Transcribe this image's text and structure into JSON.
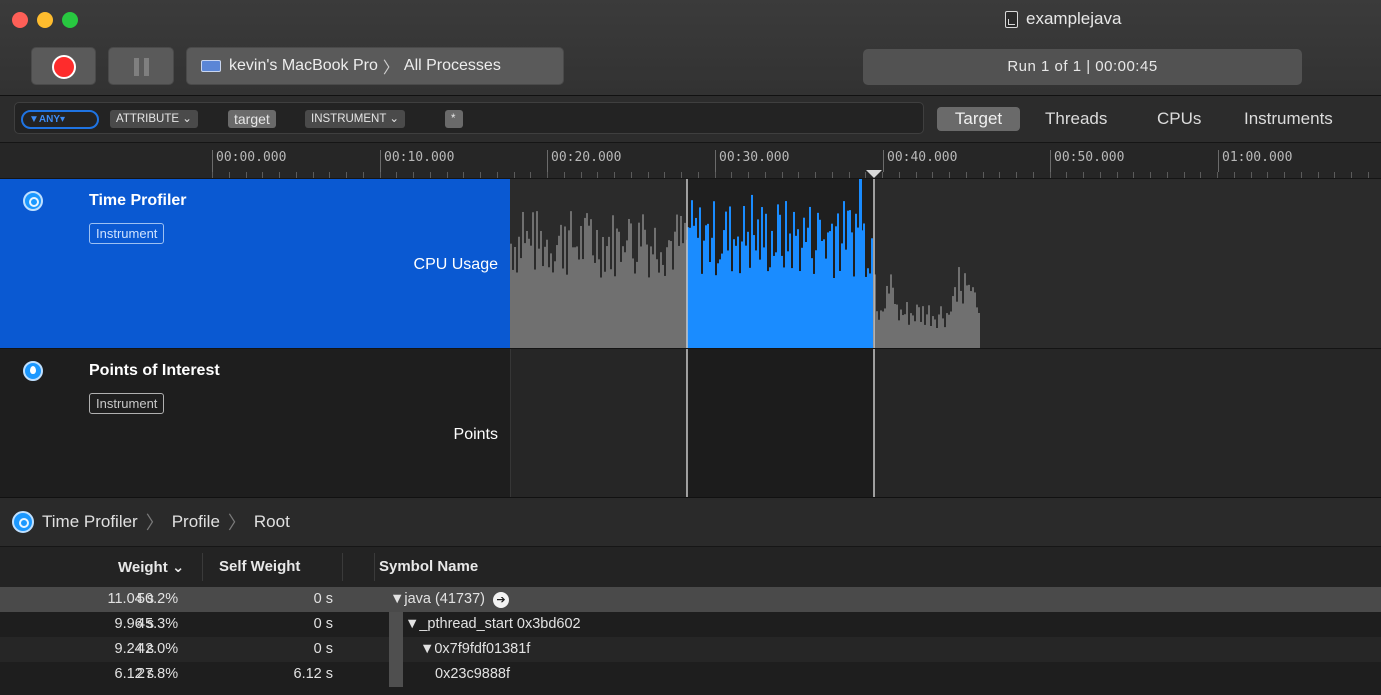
{
  "window": {
    "title": "examplejava",
    "device": "kevin's MacBook Pro",
    "device_sep": "〉",
    "target_process": "All Processes",
    "run_status": "Run 1 of 1  |  00:00:45"
  },
  "filter": {
    "any_token": "▼ANY▾",
    "attribute_token": "ATTRIBUTE ⌄",
    "target_value": "target",
    "instrument_token": "INSTRUMENT ⌄",
    "star_token": "*"
  },
  "view_tabs": [
    {
      "label": "Target",
      "selected": true
    },
    {
      "label": "Threads",
      "selected": false
    },
    {
      "label": "CPUs",
      "selected": false
    },
    {
      "label": "Instruments",
      "selected": false
    }
  ],
  "ruler": {
    "ticks": [
      "00:00.000",
      "00:10.000",
      "00:20.000",
      "00:30.000",
      "00:40.000",
      "00:50.000",
      "01:00.000"
    ]
  },
  "tracks": [
    {
      "name": "Time Profiler",
      "badge": "Instrument",
      "series": "CPU Usage",
      "selected": true
    },
    {
      "name": "Points of Interest",
      "badge": "Instrument",
      "series": "Points",
      "selected": false
    }
  ],
  "detail": {
    "breadcrumbs": [
      "Time Profiler",
      "Profile",
      "Root"
    ],
    "columns": {
      "weight": "Weight ⌄",
      "self_weight": "Self Weight",
      "symbol": "Symbol Name"
    },
    "rows": [
      {
        "weight": "11.04 s",
        "percent": "50.2%",
        "self": "0 s",
        "symbol": "▼java (41737)",
        "indent": 0,
        "selected": true,
        "goto": true
      },
      {
        "weight": "9.96 s",
        "percent": "45.3%",
        "self": "0 s",
        "symbol": "▼_pthread_start  0x3bd602",
        "indent": 1,
        "selected": false,
        "goto": false
      },
      {
        "weight": "9.24 s",
        "percent": "42.0%",
        "self": "0 s",
        "symbol": "▼0x7f9fdf01381f",
        "indent": 2,
        "selected": false,
        "goto": false
      },
      {
        "weight": "6.12 s",
        "percent": "27.8%",
        "self": "6.12 s",
        "symbol": "0x23c9888f",
        "indent": 3,
        "selected": false,
        "goto": false
      }
    ]
  },
  "colors": {
    "selection_blue": "#0a59d2",
    "cpu_bar_gray": "#707070",
    "cpu_bar_blue": "#1a8cff",
    "record_red": "#fe2c2c"
  }
}
